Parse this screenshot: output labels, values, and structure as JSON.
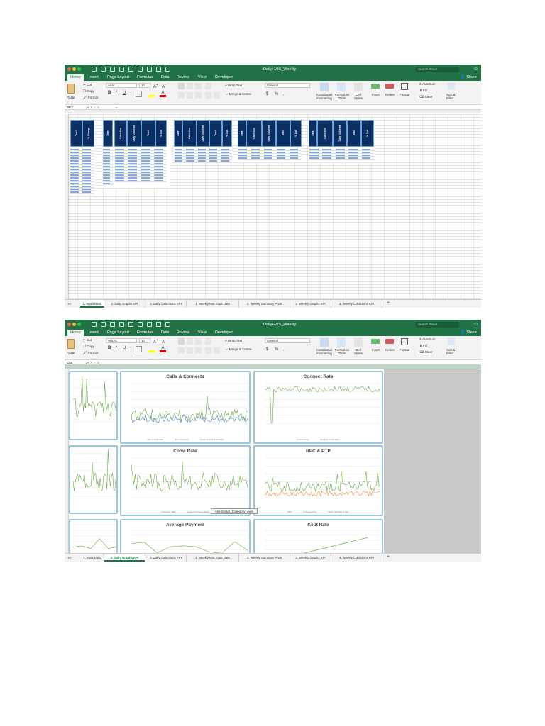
{
  "colors": {
    "excel_green": "#217346",
    "header_navy": "#0b2e63",
    "series_green": "#6aac46",
    "series_blue": "#4a78c0",
    "series_orange": "#f08c2a"
  },
  "ribbon": {
    "tabs": [
      "Home",
      "Insert",
      "Page Layout",
      "Formulas",
      "Data",
      "Review",
      "View",
      "Developer"
    ],
    "share": "Share",
    "search_placeholder": "Search Sheet",
    "paste": "Paste",
    "cut": "Cut",
    "copy": "Copy",
    "format": "Format",
    "wrap_text": "Wrap Text",
    "merge_center": "Merge & Center",
    "number_format": "General",
    "conditional_formatting": "Conditional Formatting",
    "format_as_table": "Format as Table",
    "cell_styles": "Cell Styles",
    "insert": "Insert",
    "delete": "Delete",
    "format_cells": "Format",
    "autosum": "AutoSum",
    "fill": "Fill",
    "clear": "Clear",
    "sort_filter": "Sort & Filter"
  },
  "window1": {
    "title": "Daily+MIS_Weekly",
    "font_name": "Arial",
    "font_size": "10",
    "name_box": "BE3",
    "formula": "=",
    "active_sheet": 0
  },
  "window2": {
    "title": "Daily+MIS_Weekly",
    "font_name": "ARIAL",
    "font_size": "10",
    "name_box": "C64",
    "formula": "",
    "active_sheet": 1,
    "tooltip": "Horizontal (Category) Axis"
  },
  "sheets": [
    "1. Input Data",
    "2. Daily Graphs KPI",
    "3. Daily Collections KPI",
    "1. Weekly MIS Input Data",
    "2. Weekly Summary Pivot",
    "3. Weekly Graphs KPI",
    "3. Weekly Collections KPI"
  ],
  "sheet_block_headers": {
    "block1": [
      "Total",
      "% Change"
    ],
    "block2": [
      "Date",
      "Collection",
      "Daily Collected",
      "Total",
      "% Coll"
    ],
    "block3": [
      "Date",
      "Collection",
      "Daily Collected",
      "Total",
      "% Coll"
    ],
    "block4": [
      "Date",
      "Collection",
      "Daily Collected",
      "Total",
      "% Coll"
    ],
    "block5": [
      "Date",
      "Collection",
      "Daily Collected",
      "Total",
      "% Coll"
    ]
  },
  "charts": {
    "calls_connects": {
      "title": "Calls & Connects",
      "legend": [
        "Sum of Total Calls",
        "Sum of Connect",
        "Linear (Sum of Total Calls)"
      ]
    },
    "connect_rate": {
      "title": "Connect Rate",
      "legend": [
        "Connect Rate",
        "Linear (Connect Rate)"
      ]
    },
    "conv_rate": {
      "title": "Conv. Rate",
      "legend": [
        "Conversion Rate",
        "Linear (Conversion Rate)"
      ]
    },
    "rpc_ptp": {
      "title": "RPC & PTP",
      "legend": [
        "RPC",
        "Promise to Pay",
        "Linear (Promise to Pay)"
      ]
    },
    "average_payment": {
      "title": "Average Payment"
    },
    "kept_rate": {
      "title": "Kept Rate"
    }
  }
}
